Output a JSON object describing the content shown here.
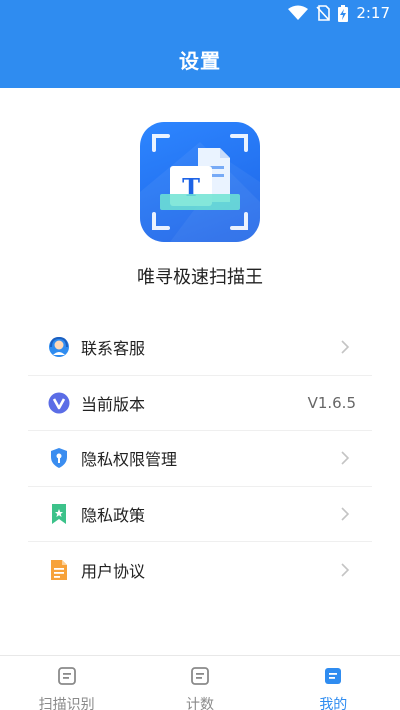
{
  "status_bar": {
    "time": "2:17"
  },
  "header": {
    "title": "设置"
  },
  "app": {
    "name": "唯寻极速扫描王"
  },
  "menu": {
    "items": [
      {
        "label": "联系客服",
        "icon": "headset-icon"
      },
      {
        "label": "当前版本",
        "icon": "version-icon",
        "value": "V1.6.5"
      },
      {
        "label": "隐私权限管理",
        "icon": "shield-icon"
      },
      {
        "label": "隐私政策",
        "icon": "bookmark-icon"
      },
      {
        "label": "用户协议",
        "icon": "document-icon"
      }
    ]
  },
  "tabs": [
    {
      "label": "扫描识别",
      "icon": "doc-tab-icon"
    },
    {
      "label": "计数",
      "icon": "doc-tab-icon"
    },
    {
      "label": "我的",
      "icon": "doc-tab-icon",
      "active": true
    }
  ],
  "colors": {
    "primary": "#2f8cf0",
    "tab_inactive": "#8a8a8a"
  }
}
